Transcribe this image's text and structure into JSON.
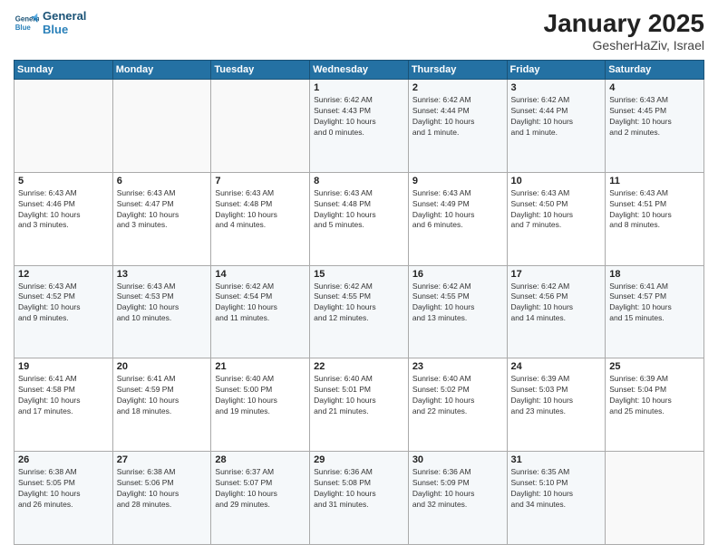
{
  "header": {
    "logo": {
      "line1": "General",
      "line2": "Blue"
    },
    "title": "January 2025",
    "location": "GesherHaZiv, Israel"
  },
  "weekdays": [
    "Sunday",
    "Monday",
    "Tuesday",
    "Wednesday",
    "Thursday",
    "Friday",
    "Saturday"
  ],
  "weeks": [
    [
      {
        "day": "",
        "info": ""
      },
      {
        "day": "",
        "info": ""
      },
      {
        "day": "",
        "info": ""
      },
      {
        "day": "1",
        "info": "Sunrise: 6:42 AM\nSunset: 4:43 PM\nDaylight: 10 hours\nand 0 minutes."
      },
      {
        "day": "2",
        "info": "Sunrise: 6:42 AM\nSunset: 4:44 PM\nDaylight: 10 hours\nand 1 minute."
      },
      {
        "day": "3",
        "info": "Sunrise: 6:42 AM\nSunset: 4:44 PM\nDaylight: 10 hours\nand 1 minute."
      },
      {
        "day": "4",
        "info": "Sunrise: 6:43 AM\nSunset: 4:45 PM\nDaylight: 10 hours\nand 2 minutes."
      }
    ],
    [
      {
        "day": "5",
        "info": "Sunrise: 6:43 AM\nSunset: 4:46 PM\nDaylight: 10 hours\nand 3 minutes."
      },
      {
        "day": "6",
        "info": "Sunrise: 6:43 AM\nSunset: 4:47 PM\nDaylight: 10 hours\nand 3 minutes."
      },
      {
        "day": "7",
        "info": "Sunrise: 6:43 AM\nSunset: 4:48 PM\nDaylight: 10 hours\nand 4 minutes."
      },
      {
        "day": "8",
        "info": "Sunrise: 6:43 AM\nSunset: 4:48 PM\nDaylight: 10 hours\nand 5 minutes."
      },
      {
        "day": "9",
        "info": "Sunrise: 6:43 AM\nSunset: 4:49 PM\nDaylight: 10 hours\nand 6 minutes."
      },
      {
        "day": "10",
        "info": "Sunrise: 6:43 AM\nSunset: 4:50 PM\nDaylight: 10 hours\nand 7 minutes."
      },
      {
        "day": "11",
        "info": "Sunrise: 6:43 AM\nSunset: 4:51 PM\nDaylight: 10 hours\nand 8 minutes."
      }
    ],
    [
      {
        "day": "12",
        "info": "Sunrise: 6:43 AM\nSunset: 4:52 PM\nDaylight: 10 hours\nand 9 minutes."
      },
      {
        "day": "13",
        "info": "Sunrise: 6:43 AM\nSunset: 4:53 PM\nDaylight: 10 hours\nand 10 minutes."
      },
      {
        "day": "14",
        "info": "Sunrise: 6:42 AM\nSunset: 4:54 PM\nDaylight: 10 hours\nand 11 minutes."
      },
      {
        "day": "15",
        "info": "Sunrise: 6:42 AM\nSunset: 4:55 PM\nDaylight: 10 hours\nand 12 minutes."
      },
      {
        "day": "16",
        "info": "Sunrise: 6:42 AM\nSunset: 4:55 PM\nDaylight: 10 hours\nand 13 minutes."
      },
      {
        "day": "17",
        "info": "Sunrise: 6:42 AM\nSunset: 4:56 PM\nDaylight: 10 hours\nand 14 minutes."
      },
      {
        "day": "18",
        "info": "Sunrise: 6:41 AM\nSunset: 4:57 PM\nDaylight: 10 hours\nand 15 minutes."
      }
    ],
    [
      {
        "day": "19",
        "info": "Sunrise: 6:41 AM\nSunset: 4:58 PM\nDaylight: 10 hours\nand 17 minutes."
      },
      {
        "day": "20",
        "info": "Sunrise: 6:41 AM\nSunset: 4:59 PM\nDaylight: 10 hours\nand 18 minutes."
      },
      {
        "day": "21",
        "info": "Sunrise: 6:40 AM\nSunset: 5:00 PM\nDaylight: 10 hours\nand 19 minutes."
      },
      {
        "day": "22",
        "info": "Sunrise: 6:40 AM\nSunset: 5:01 PM\nDaylight: 10 hours\nand 21 minutes."
      },
      {
        "day": "23",
        "info": "Sunrise: 6:40 AM\nSunset: 5:02 PM\nDaylight: 10 hours\nand 22 minutes."
      },
      {
        "day": "24",
        "info": "Sunrise: 6:39 AM\nSunset: 5:03 PM\nDaylight: 10 hours\nand 23 minutes."
      },
      {
        "day": "25",
        "info": "Sunrise: 6:39 AM\nSunset: 5:04 PM\nDaylight: 10 hours\nand 25 minutes."
      }
    ],
    [
      {
        "day": "26",
        "info": "Sunrise: 6:38 AM\nSunset: 5:05 PM\nDaylight: 10 hours\nand 26 minutes."
      },
      {
        "day": "27",
        "info": "Sunrise: 6:38 AM\nSunset: 5:06 PM\nDaylight: 10 hours\nand 28 minutes."
      },
      {
        "day": "28",
        "info": "Sunrise: 6:37 AM\nSunset: 5:07 PM\nDaylight: 10 hours\nand 29 minutes."
      },
      {
        "day": "29",
        "info": "Sunrise: 6:36 AM\nSunset: 5:08 PM\nDaylight: 10 hours\nand 31 minutes."
      },
      {
        "day": "30",
        "info": "Sunrise: 6:36 AM\nSunset: 5:09 PM\nDaylight: 10 hours\nand 32 minutes."
      },
      {
        "day": "31",
        "info": "Sunrise: 6:35 AM\nSunset: 5:10 PM\nDaylight: 10 hours\nand 34 minutes."
      },
      {
        "day": "",
        "info": ""
      }
    ]
  ]
}
